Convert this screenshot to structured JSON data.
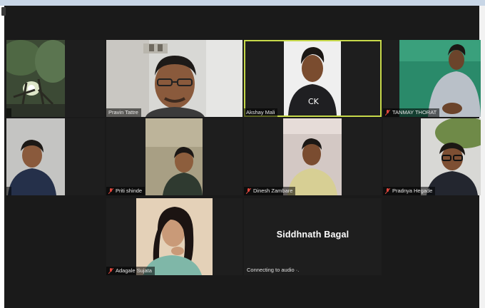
{
  "meeting": {
    "participants": [
      {
        "name": "",
        "muted": false
      },
      {
        "name": "Pravin Tattre",
        "muted": false
      },
      {
        "name": "Akshay Mali",
        "muted": false,
        "active_speaker": true
      },
      {
        "name": "TANMAY THORAT",
        "muted": true
      },
      {
        "name": "",
        "muted": false
      },
      {
        "name": "Priti shinde",
        "muted": true
      },
      {
        "name": "Dinesh Zambare",
        "muted": true
      },
      {
        "name": "Pradnya Hegade",
        "muted": true
      },
      {
        "name": "Adagale Sujata",
        "muted": true
      },
      {
        "name": "Siddhnath Bagal",
        "muted": false,
        "video_off": true,
        "status": "Connecting to audio ·."
      }
    ],
    "colors": {
      "active_speaker_border": "#c7d94a",
      "mute_icon": "#e0463c",
      "background": "#1a1a1a"
    }
  }
}
